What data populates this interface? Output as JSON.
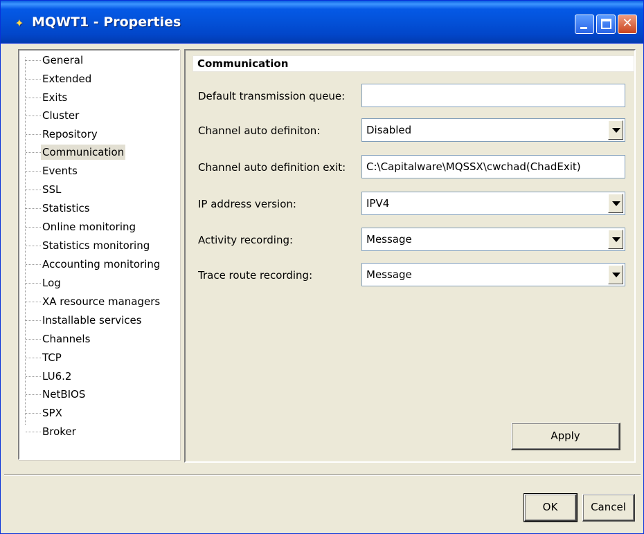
{
  "window": {
    "title": "MQWT1 - Properties",
    "icon": "mq-app-icon",
    "controls": {
      "minimize": "minimize",
      "maximize": "maximize",
      "close": "✕"
    }
  },
  "tree": {
    "items": [
      {
        "label": "General"
      },
      {
        "label": "Extended"
      },
      {
        "label": "Exits"
      },
      {
        "label": "Cluster"
      },
      {
        "label": "Repository"
      },
      {
        "label": "Communication",
        "selected": true
      },
      {
        "label": "Events"
      },
      {
        "label": "SSL"
      },
      {
        "label": "Statistics"
      },
      {
        "label": "Online monitoring"
      },
      {
        "label": "Statistics monitoring"
      },
      {
        "label": "Accounting monitoring"
      },
      {
        "label": "Log"
      },
      {
        "label": "XA resource managers"
      },
      {
        "label": "Installable services"
      },
      {
        "label": "Channels"
      },
      {
        "label": "TCP"
      },
      {
        "label": "LU6.2"
      },
      {
        "label": "NetBIOS"
      },
      {
        "label": "SPX"
      },
      {
        "label": "Broker"
      }
    ]
  },
  "panel": {
    "header": "Communication",
    "fields": {
      "default_xmitq": {
        "label": "Default transmission queue:",
        "value": ""
      },
      "chad": {
        "label": "Channel auto definiton:",
        "value": "Disabled"
      },
      "chad_exit": {
        "label": "Channel auto definition exit:",
        "value": "C:\\Capitalware\\MQSSX\\cwchad(ChadExit)"
      },
      "ip_version": {
        "label": "IP address version:",
        "value": "IPV4"
      },
      "activity_recording": {
        "label": "Activity recording:",
        "value": "Message"
      },
      "trace_route": {
        "label": "Trace route recording:",
        "value": "Message"
      }
    },
    "apply_label": "Apply"
  },
  "footer": {
    "ok_label": "OK",
    "cancel_label": "Cancel"
  }
}
